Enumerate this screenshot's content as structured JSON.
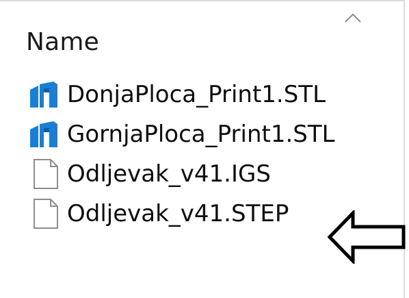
{
  "list": {
    "column_header": "Name",
    "sort_indicator": "chevron-up-icon",
    "files": [
      {
        "name": "DonjaPloca_Print1.STL",
        "icon": "stl-file-icon"
      },
      {
        "name": "GornjaPloca_Print1.STL",
        "icon": "stl-file-icon"
      },
      {
        "name": "Odljevak_v41.IGS",
        "icon": "blank-file-icon"
      },
      {
        "name": "Odljevak_v41.STEP",
        "icon": "blank-file-icon"
      }
    ]
  },
  "annotation": {
    "type": "left-arrow-icon",
    "target": "Odljevak_v41.STEP"
  },
  "colors": {
    "stl_icon": "#1a7fd4",
    "blank_icon_stroke": "#8c8c8c",
    "border": "#dcdcdc",
    "text": "#000000"
  }
}
